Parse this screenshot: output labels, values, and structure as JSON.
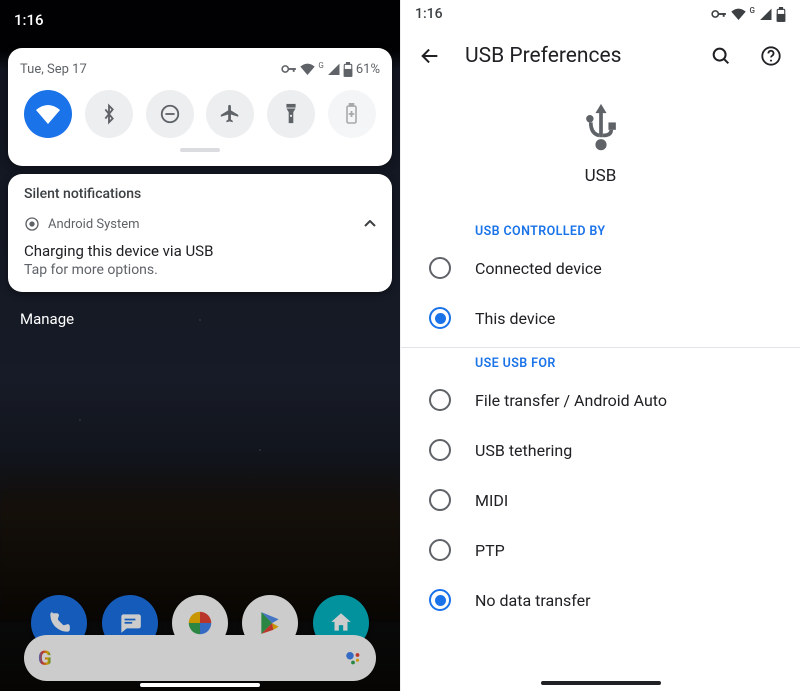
{
  "left": {
    "statusbar_time": "1:16",
    "qs": {
      "date": "Tue, Sep 17",
      "battery_pct": "61%",
      "tiles": [
        {
          "name": "wifi",
          "active": true
        },
        {
          "name": "bluetooth",
          "active": false
        },
        {
          "name": "dnd",
          "active": false
        },
        {
          "name": "airplane",
          "active": false
        },
        {
          "name": "flashlight",
          "active": false
        },
        {
          "name": "battery-saver",
          "active": false
        }
      ]
    },
    "silent_label": "Silent notifications",
    "notification": {
      "app": "Android System",
      "title": "Charging this device via USB",
      "sub": "Tap for more options."
    },
    "manage": "Manage"
  },
  "right": {
    "statusbar_time": "1:16",
    "title": "USB Preferences",
    "hero_label": "USB",
    "section_controlled": "USB CONTROLLED BY",
    "controlled_options": [
      {
        "label": "Connected device",
        "checked": false
      },
      {
        "label": "This device",
        "checked": true
      }
    ],
    "section_usefor": "USE USB FOR",
    "usefor_options": [
      {
        "label": "File transfer / Android Auto",
        "checked": false
      },
      {
        "label": "USB tethering",
        "checked": false
      },
      {
        "label": "MIDI",
        "checked": false
      },
      {
        "label": "PTP",
        "checked": false
      },
      {
        "label": "No data transfer",
        "checked": true
      }
    ]
  },
  "colors": {
    "accent": "#1a73e8"
  }
}
